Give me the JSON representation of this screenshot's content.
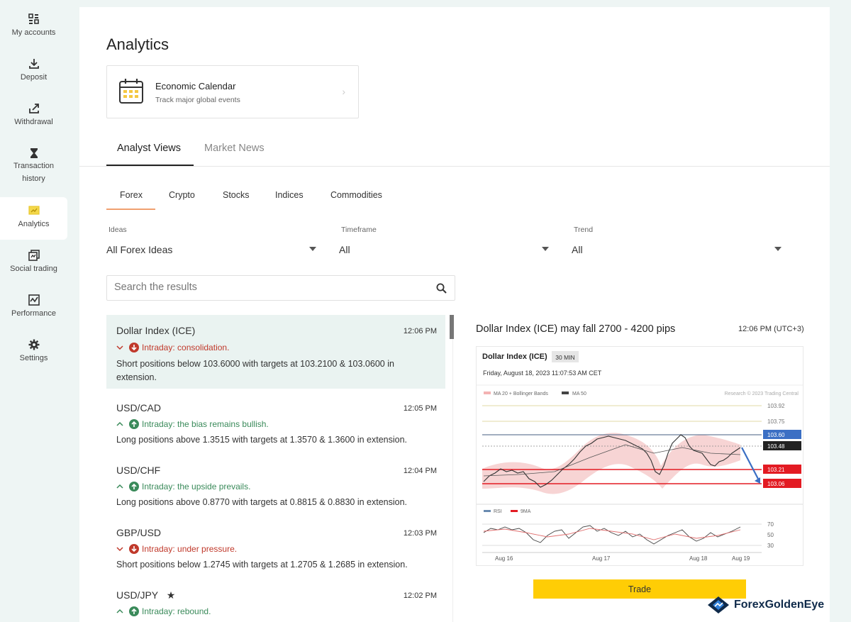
{
  "sidebar": {
    "items": [
      {
        "label": "My accounts",
        "icon": "accounts-grid-icon"
      },
      {
        "label": "Deposit",
        "icon": "download-icon"
      },
      {
        "label": "Withdrawal",
        "icon": "upload-share-icon"
      },
      {
        "label": "Transaction history",
        "icon": "hourglass-icon"
      },
      {
        "label": "Analytics",
        "icon": "analytics-icon"
      },
      {
        "label": "Social trading",
        "icon": "social-trading-icon"
      },
      {
        "label": "Performance",
        "icon": "performance-chart-icon"
      },
      {
        "label": "Settings",
        "icon": "gear-icon"
      }
    ],
    "active": "Analytics",
    "accent_color": "#e8c830"
  },
  "page": {
    "title": "Analytics",
    "calendar_card": {
      "title": "Economic Calendar",
      "subtitle": "Track major global events"
    },
    "tabs": [
      {
        "label": "Analyst Views"
      },
      {
        "label": "Market News"
      }
    ],
    "subtabs": [
      {
        "label": "Forex"
      },
      {
        "label": "Crypto"
      },
      {
        "label": "Stocks"
      },
      {
        "label": "Indices"
      },
      {
        "label": "Commodities"
      }
    ],
    "filters": [
      {
        "label": "Ideas",
        "value": "All Forex Ideas"
      },
      {
        "label": "Timeframe",
        "value": "All"
      },
      {
        "label": "Trend",
        "value": "All"
      }
    ],
    "search": {
      "placeholder": "Search the results"
    }
  },
  "ideas": [
    {
      "pair": "Dollar Index (ICE)",
      "time": "12:06 PM",
      "direction": "down",
      "trend": "Intraday: consolidation.",
      "desc": "Short positions below 103.6000 with targets at 103.2100 & 103.0600 in extension."
    },
    {
      "pair": "USD/CAD",
      "time": "12:05 PM",
      "direction": "up",
      "trend": "Intraday: the bias remains bullish.",
      "desc": "Long positions above 1.3515 with targets at 1.3570 & 1.3600 in extension."
    },
    {
      "pair": "USD/CHF",
      "time": "12:04 PM",
      "direction": "up",
      "trend": "Intraday: the upside prevails.",
      "desc": "Long positions above 0.8770 with targets at 0.8815 & 0.8830 in extension."
    },
    {
      "pair": "GBP/USD",
      "time": "12:03 PM",
      "direction": "down",
      "trend": "Intraday: under pressure.",
      "desc": "Short positions below 1.2745 with targets at 1.2705 & 1.2685 in extension."
    },
    {
      "pair": "USD/JPY",
      "time": "12:02 PM",
      "direction": "up",
      "trend": "Intraday: rebound.",
      "desc": "",
      "starred": true
    }
  ],
  "detail": {
    "title": "Dollar Index (ICE) may fall 2700 - 4200 pips",
    "time": "12:06 PM (UTC+3)",
    "trade_label": "Trade",
    "chart": {
      "symbol": "Dollar Index (ICE)",
      "interval": "30 MIN",
      "datetime": "Friday, August 18, 2023 11:07:53 AM CET",
      "legend_ma20": "MA 20 + Bollinger Bands",
      "legend_ma50": "MA 50",
      "credit": "Research © 2023 Trading Central",
      "levels": {
        "l1": "103.92",
        "l2": "103.75",
        "l3": "103.60",
        "l4": "103.48",
        "l5": "103.21",
        "l6": "103.06"
      },
      "rsi_legend": "RSI",
      "ma9_legend": "9MA",
      "rsi_ticks": [
        "70",
        "50",
        "30"
      ],
      "x_labels": [
        "Aug 16",
        "Aug 17",
        "Aug 18",
        "Aug 19"
      ],
      "level_colors": {
        "support": "#e31b23",
        "resistance": "#3b6fc4",
        "current": "#222222"
      }
    }
  },
  "brand": {
    "name": "ForexGoldenEye"
  }
}
